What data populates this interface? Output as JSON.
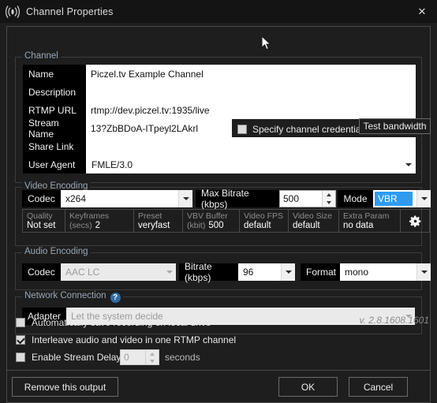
{
  "window": {
    "title": "Channel Properties",
    "icon": "broadcast-icon",
    "close_label": "✕",
    "version": "v. 2.8.1608.1601"
  },
  "channel": {
    "section_title": "Channel",
    "fields": [
      {
        "label": "Name",
        "value": "Piczel.tv Example Channel"
      },
      {
        "label": "Description",
        "value": ""
      },
      {
        "label": "RTMP URL",
        "value": "rtmp://dev.piczel.tv:1935/live"
      },
      {
        "label": "Stream Name",
        "value": "13?ZbBDoA-ITpeyl2LAkrl"
      },
      {
        "label": "Share Link",
        "value": ""
      },
      {
        "label": "User Agent",
        "value": "FMLE/3.0"
      }
    ],
    "credentials_checkbox": {
      "label": "Specify channel credentials",
      "checked": false
    },
    "test_bandwidth_button": "Test bandwidth"
  },
  "video": {
    "section_title": "Video Encoding",
    "codec_label": "Codec",
    "codec_value": "x264",
    "max_bitrate_label": "Max Bitrate (kbps)",
    "max_bitrate_value": "500",
    "mode_label": "Mode",
    "mode_value": "VBR",
    "mode_highlight": "#2f9bf0",
    "params": [
      {
        "key": "Quality",
        "value": "Not set"
      },
      {
        "key": "Keyframes",
        "sub": "(secs)",
        "value": "2"
      },
      {
        "key": "Preset",
        "value": "veryfast"
      },
      {
        "key": "VBV Buffer",
        "sub": "(kbit)",
        "value": "500"
      },
      {
        "key": "Video FPS",
        "value": "default"
      },
      {
        "key": "Video Size",
        "value": "default"
      },
      {
        "key": "Extra Param",
        "value": "no data"
      }
    ],
    "settings_icon": "gear-icon"
  },
  "audio": {
    "section_title": "Audio Encoding",
    "codec_label": "Codec",
    "codec_value": "AAC LC",
    "bitrate_label": "Bitrate (kbps)",
    "bitrate_value": "96",
    "format_label": "Format",
    "format_value": "mono"
  },
  "network": {
    "section_title": "Network Connection",
    "help_icon": "?",
    "adapter_label": "Adapter",
    "adapter_value": "Let the system decide"
  },
  "options": {
    "auto_save": {
      "label": "Automatically save recording on local drive",
      "checked": false
    },
    "interleave": {
      "label": "Interleave audio and video in one RTMP channel",
      "checked": true
    },
    "delay": {
      "label": "Enable Stream Delay",
      "checked": false,
      "value": "0",
      "unit": "seconds"
    }
  },
  "footer": {
    "remove_label": "Remove this output",
    "ok_label": "OK",
    "cancel_label": "Cancel"
  }
}
